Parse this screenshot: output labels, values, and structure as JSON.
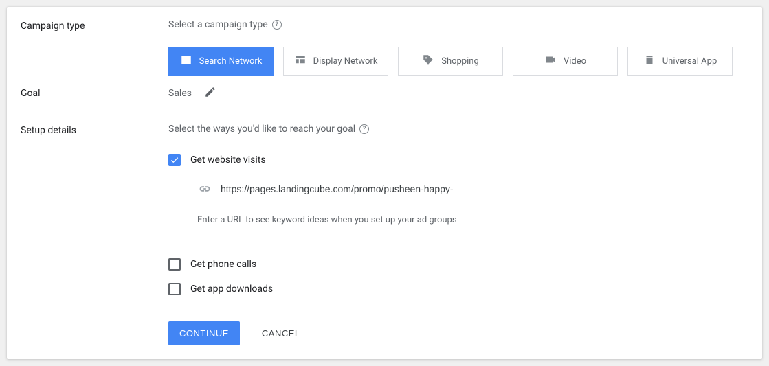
{
  "campaign": {
    "label": "Campaign type",
    "subtitle": "Select a campaign type",
    "tabs": [
      {
        "label": "Search Network"
      },
      {
        "label": "Display Network"
      },
      {
        "label": "Shopping"
      },
      {
        "label": "Video"
      },
      {
        "label": "Universal App"
      }
    ]
  },
  "goal": {
    "label": "Goal",
    "value": "Sales"
  },
  "setup": {
    "label": "Setup details",
    "subtitle": "Select the ways you'd like to reach your goal",
    "visits_label": "Get website visits",
    "url_value": "https://pages.landingcube.com/promo/pusheen-happy-",
    "url_hint": "Enter a URL to see keyword ideas when you set up your ad groups",
    "phone_label": "Get phone calls",
    "app_label": "Get app downloads"
  },
  "actions": {
    "continue": "CONTINUE",
    "cancel": "CANCEL"
  }
}
